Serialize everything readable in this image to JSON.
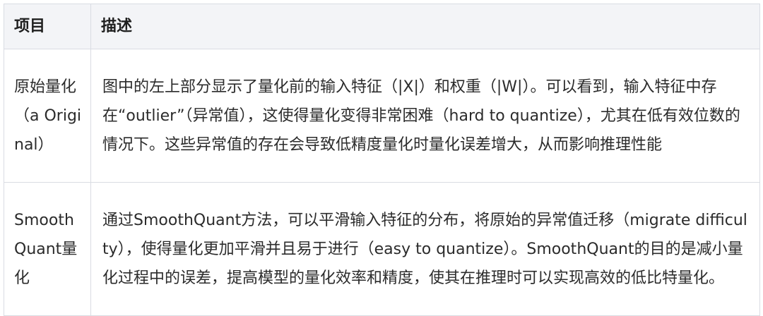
{
  "table": {
    "headers": {
      "item": "项目",
      "description": "描述"
    },
    "rows": [
      {
        "item": "原始量化（a Original）",
        "description": "图中的左上部分显示了量化前的输入特征（|X|）和权重（|W|）。可以看到，输入特征中存在“outlier”（异常值），这使得量化变得非常困难（hard to quantize），尤其在低有效位数的情况下。这些异常值的存在会导致低精度量化时量化误差增大，从而影响推理性能"
      },
      {
        "item": "SmoothQuant量化",
        "description": "通过SmoothQuant方法，可以平滑输入特征的分布，将原始的异常值迁移（migrate difficulty），使得量化更加平滑并且易于进行（easy to quantize）。SmoothQuant的目的是减小量化过程中的误差，提高模型的量化效率和精度，使其在推理时可以实现高效的低比特量化。"
      }
    ]
  }
}
